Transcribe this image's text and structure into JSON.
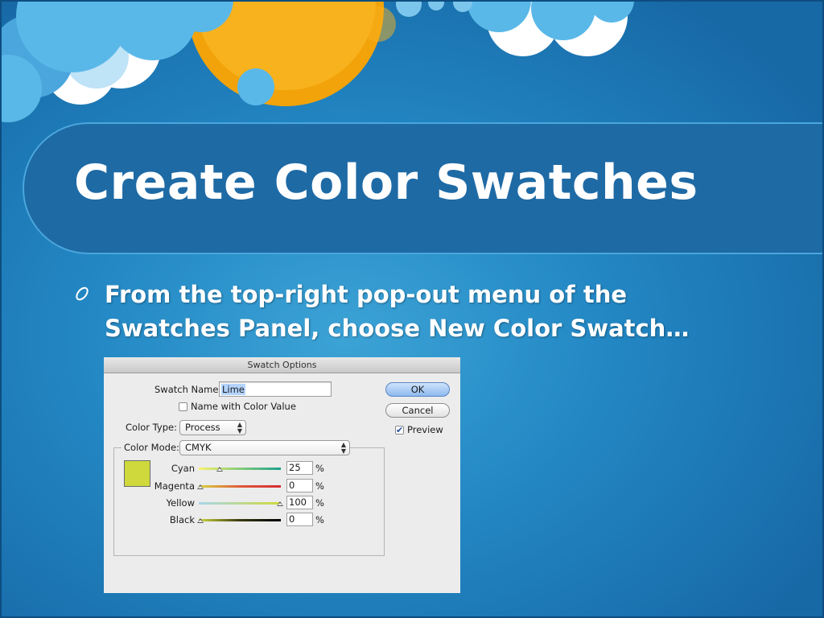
{
  "slide": {
    "title": "Create Color Swatches",
    "bullet": "From the top-right pop-out menu of  the Swatches Panel, choose New Color Swatch…"
  },
  "dialog": {
    "title": "Swatch Options",
    "swatch_name_label": "Swatch Name:",
    "swatch_name_value": "Lime",
    "name_with_color_value_label": "Name with Color Value",
    "name_with_color_value_checked": false,
    "color_type_label": "Color Type:",
    "color_type_value": "Process",
    "color_mode_label": "Color Mode:",
    "color_mode_value": "CMYK",
    "ok_label": "OK",
    "cancel_label": "Cancel",
    "preview_label": "Preview",
    "preview_checked": true,
    "swatch_color": "#cfd93c",
    "channels": [
      {
        "name": "Cyan",
        "value": "25",
        "unit": "%"
      },
      {
        "name": "Magenta",
        "value": "0",
        "unit": "%"
      },
      {
        "name": "Yellow",
        "value": "100",
        "unit": "%"
      },
      {
        "name": "Black",
        "value": "0",
        "unit": "%"
      }
    ]
  },
  "colors": {
    "background": "#2388c4",
    "title_band": "#1e6aa5",
    "cloud": "#5ab8e8",
    "sun": "#f5a80c"
  }
}
